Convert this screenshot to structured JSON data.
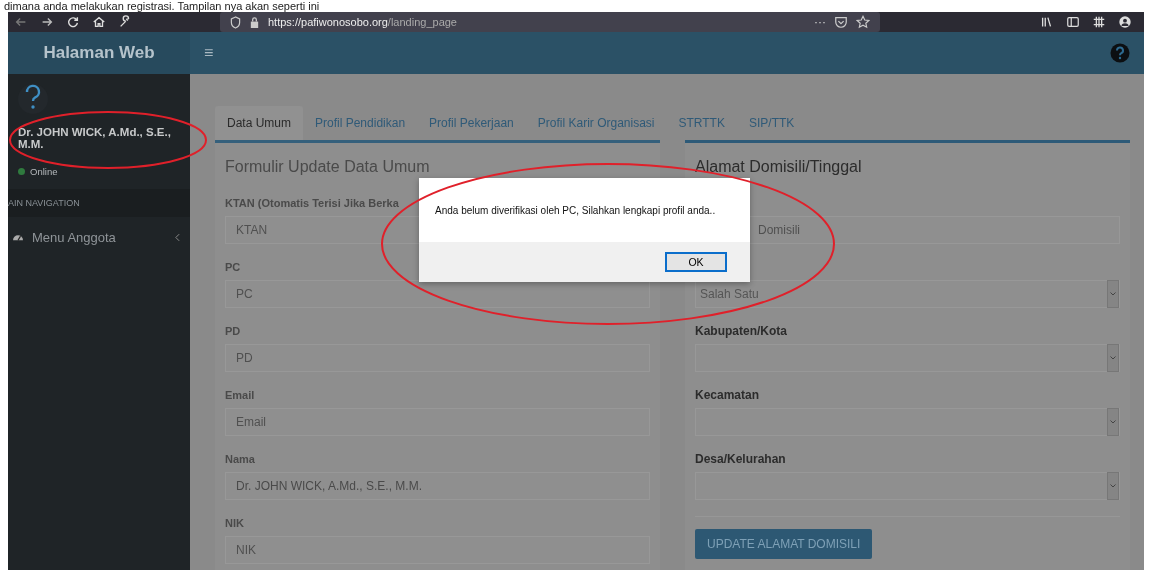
{
  "document_caption": "dimana anda melakukan registrasi. Tampilan nya akan seperti ini",
  "browser": {
    "url_domain": "https://pafiwonosobo.org",
    "url_path": "/landing_page",
    "overflow_menu": "···"
  },
  "header": {
    "brand": "Halaman Web",
    "menu_glyph": "≡"
  },
  "sidebar": {
    "user_name": "Dr. JOHN WICK, A.Md., S.E., M.M.",
    "status": "Online",
    "section_label": "AIN NAVIGATION",
    "items": [
      {
        "label": "Menu Anggota",
        "expanded": false
      }
    ]
  },
  "tabs": [
    {
      "label": "Data Umum",
      "selected": true
    },
    {
      "label": "Profil Pendidikan",
      "selected": false
    },
    {
      "label": "Profil Pekerjaan",
      "selected": false
    },
    {
      "label": "Profil Karir Organisasi",
      "selected": false
    },
    {
      "label": "STRTTK",
      "selected": false
    },
    {
      "label": "SIP/TTK",
      "selected": false
    }
  ],
  "form_left": {
    "title": "Formulir Update Data Umum",
    "fields": [
      {
        "label": "KTAN (Otomatis Terisi Jika Berka",
        "placeholder": "KTAN"
      },
      {
        "label": "PC",
        "placeholder": "PC"
      },
      {
        "label": "PD",
        "placeholder": "PD"
      },
      {
        "label": "Email",
        "placeholder": "Email"
      },
      {
        "label": "Nama",
        "value": "Dr. JOHN WICK, A.Md., S.E., M.M."
      },
      {
        "label": "NIK",
        "placeholder": "NIK"
      }
    ]
  },
  "form_right": {
    "title": "Alamat Domisili/Tinggal",
    "fields": [
      {
        "kind": "input",
        "placeholder": "Domisili"
      },
      {
        "kind": "select",
        "value": "Salah Satu"
      },
      {
        "kind": "select",
        "label": "Kabupaten/Kota"
      },
      {
        "kind": "select",
        "label": "Kecamatan"
      },
      {
        "kind": "select",
        "label": "Desa/Kelurahan"
      }
    ],
    "button": "UPDATE ALAMAT DOMISILI"
  },
  "dialog": {
    "message": "Anda belum diverifikasi oleh PC, Silahkan lengkapi profil anda..",
    "button": "OK"
  }
}
